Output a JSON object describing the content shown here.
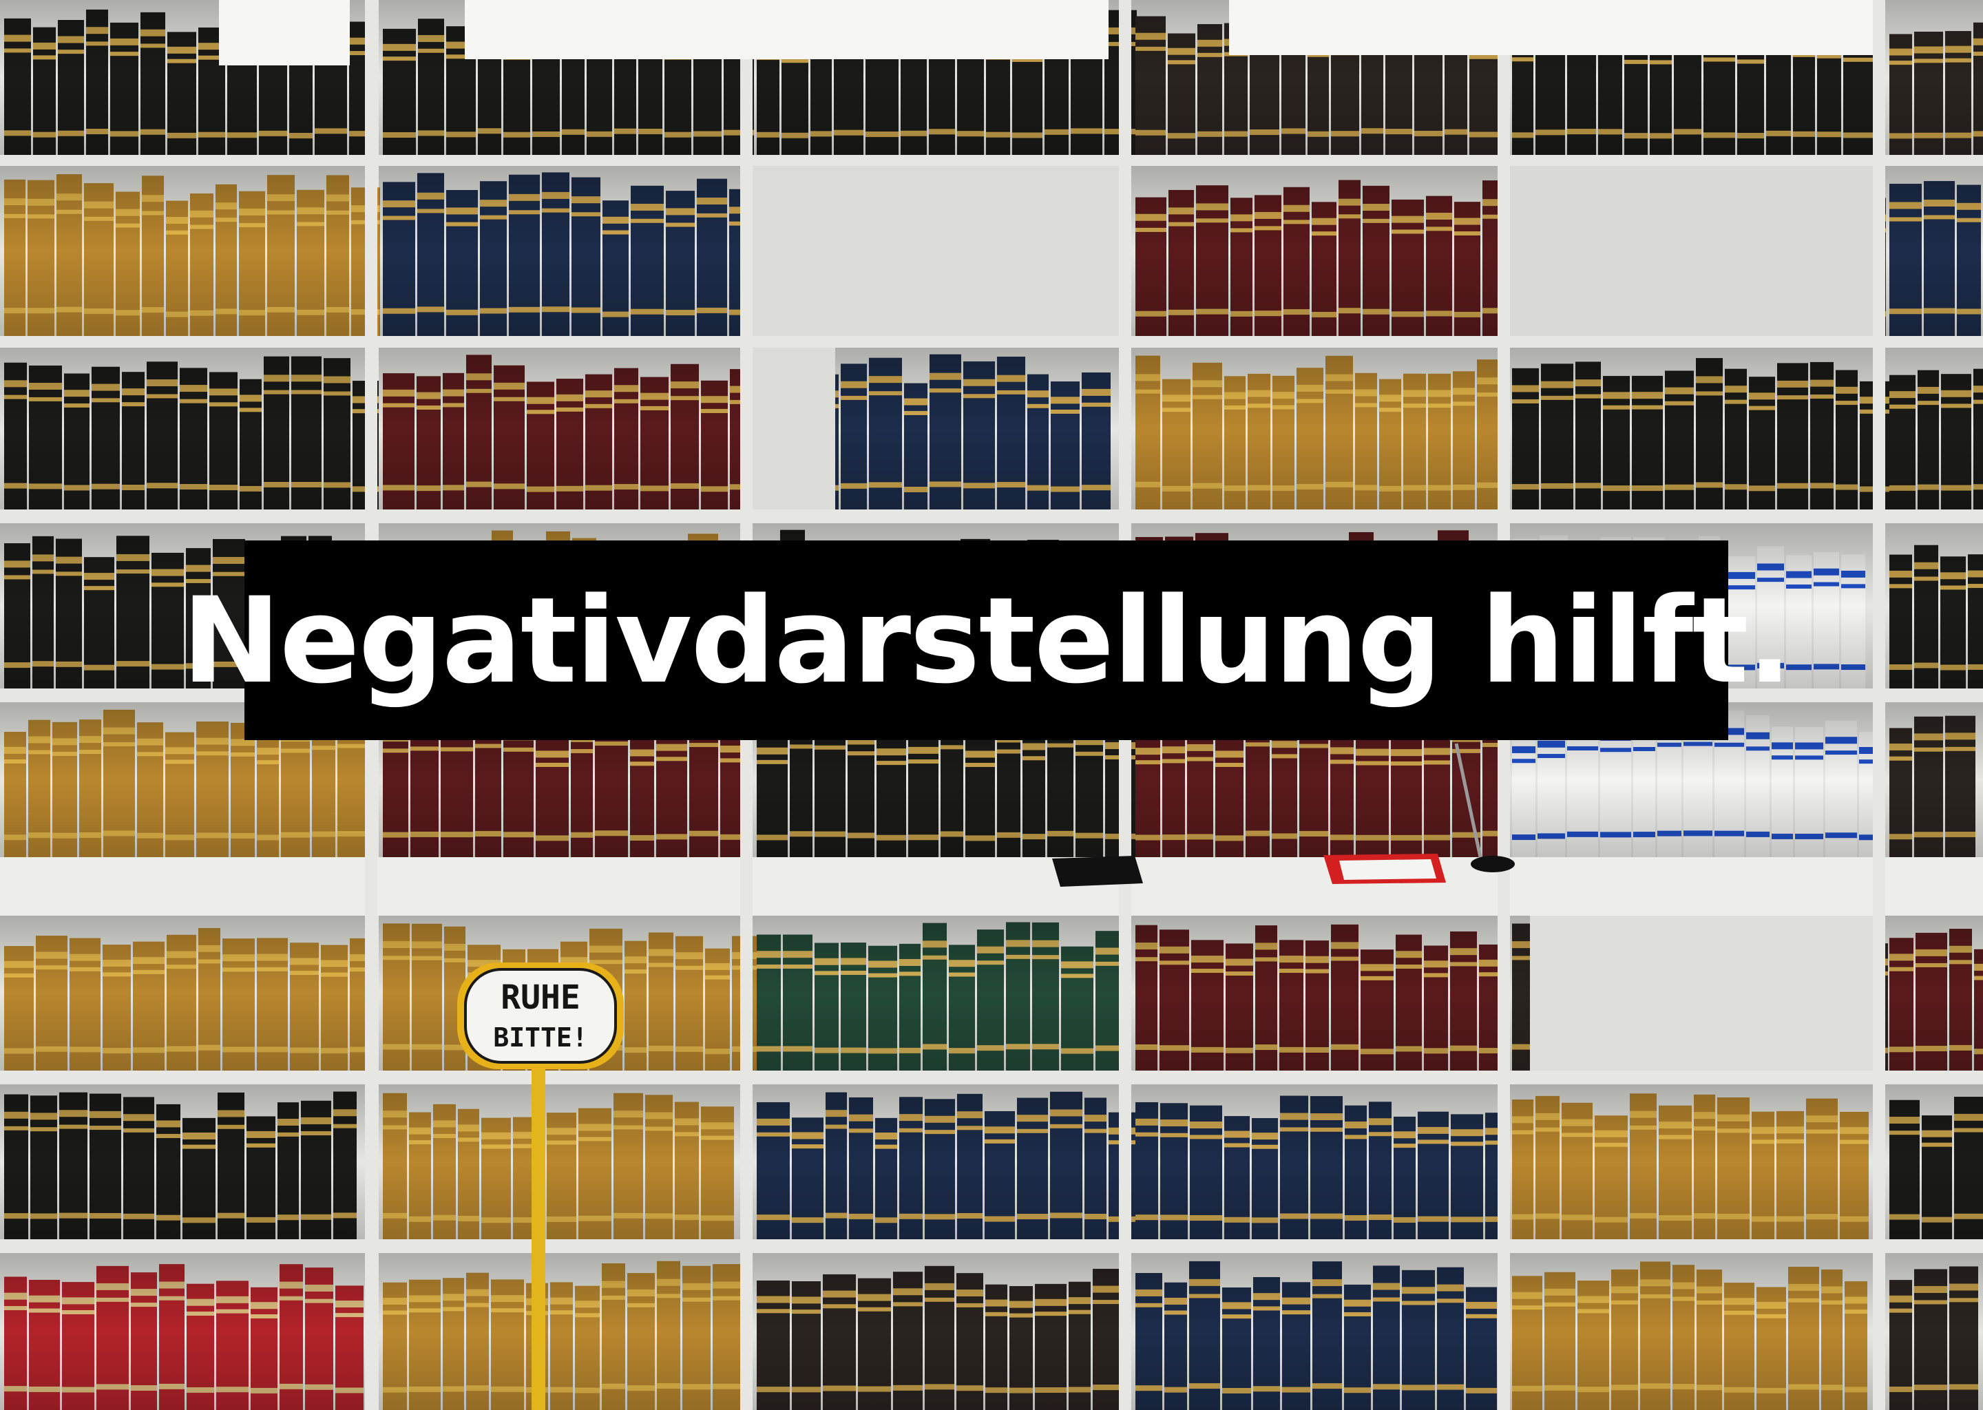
{
  "image": {
    "description_name": "library-bookshelf-photo"
  },
  "caption": {
    "text": "Negativdarstellung hilft."
  },
  "sign": {
    "line1": "RUHE",
    "line2": "BITTE!"
  },
  "colors": {
    "caption_background": "#000000",
    "caption_text": "#ffffff",
    "shelf": "#e6e6e2",
    "book_black": "#1a1a18",
    "book_maroon": "#5a1a1c",
    "book_navy": "#1c2c4a",
    "book_gold": "#b9872e",
    "book_red": "#b3232a",
    "book_green": "#234a37",
    "book_white": "#f4f4f2",
    "book_blue_band": "#1f4fc8"
  }
}
